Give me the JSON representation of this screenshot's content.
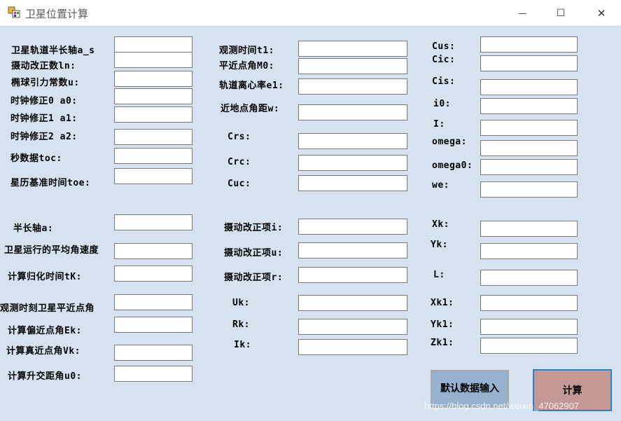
{
  "window": {
    "title": "卫星位置计算",
    "minimize_glyph": "—",
    "maximize_glyph": "☐",
    "close_glyph": "✕"
  },
  "col1": [
    "卫星轨道半长轴a_s",
    "摄动改正数ln:",
    "椭球引力常数u:",
    "时钟修正0 a0:",
    "时钟修正1 a1:",
    "时钟修正2 a2:",
    "秒数据toc:",
    "星历基准时间toe:",
    "半长轴a:",
    "卫星运行的平均角速度",
    "计算归化时间tK:",
    "观测时刻卫星平近点角",
    "计算偏近点角Ek:",
    "计算真近点角Vk:",
    "计算升交距角u0:"
  ],
  "col2": [
    "观测时间t1:",
    "平近点角M0:",
    "轨道离心率e1:",
    "近地点角距w:",
    "Crs:",
    "Crc:",
    "Cuc:",
    "摄动改正项i:",
    "摄动改正项u:",
    "摄动改正项r:",
    "Uk:",
    "Rk:",
    "Ik:"
  ],
  "col3": [
    "Cus:",
    "Cic:",
    "Cis:",
    "i0:",
    "I:",
    "omega:",
    "omega0:",
    "we:",
    "Xk:",
    "Yk:",
    "L:",
    "Xk1:",
    "Yk1:",
    "Zk1:"
  ],
  "buttons": {
    "default_input": "默认数据输入",
    "calculate": "计算"
  },
  "watermark": "https://blog.csdn.net/weixin_47062907",
  "colors": {
    "background": "#d6e2f0",
    "default_button": "#96b2cf",
    "calc_button": "#c49895",
    "calc_border": "#2a7fd4"
  }
}
